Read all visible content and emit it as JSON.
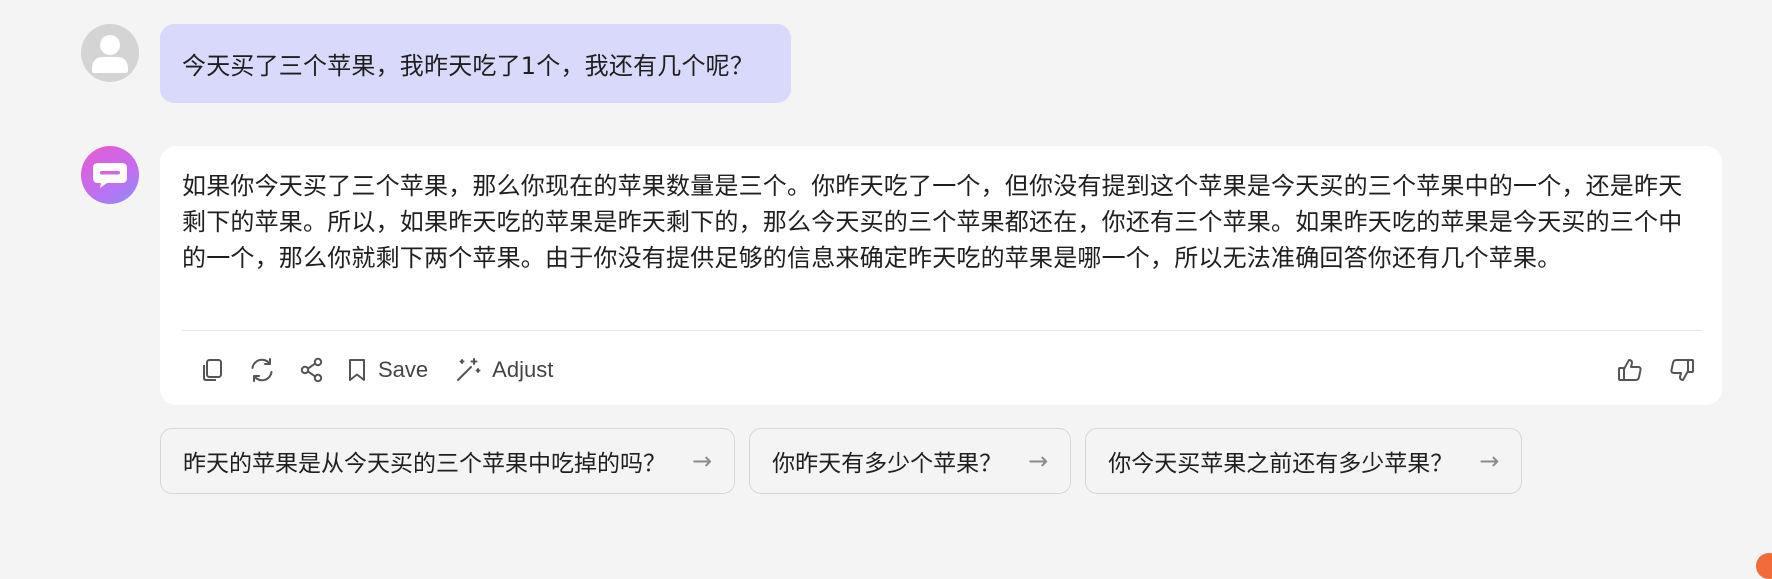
{
  "user_message": {
    "text": "今天买了三个苹果，我昨天吃了1个，我还有几个呢？"
  },
  "bot_message": {
    "text": "如果你今天买了三个苹果，那么你现在的苹果数量是三个。你昨天吃了一个，但你没有提到这个苹果是今天买的三个苹果中的一个，还是昨天剩下的苹果。所以，如果昨天吃的苹果是昨天剩下的，那么今天买的三个苹果都还在，你还有三个苹果。如果昨天吃的苹果是今天买的三个中的一个，那么你就剩下两个苹果。由于你没有提供足够的信息来确定昨天吃的苹果是哪一个，所以无法准确回答你还有几个苹果。"
  },
  "actions": {
    "copy_icon": "copy-icon",
    "regenerate_icon": "refresh-icon",
    "share_icon": "share-icon",
    "save_label": "Save",
    "adjust_label": "Adjust",
    "like_icon": "thumbs-up-icon",
    "dislike_icon": "thumbs-down-icon"
  },
  "suggestions": [
    {
      "text": "昨天的苹果是从今天买的三个苹果中吃掉的吗？",
      "arrow": "→"
    },
    {
      "text": "你昨天有多少个苹果？",
      "arrow": "→"
    },
    {
      "text": "你今天买苹果之前还有多少苹果？",
      "arrow": "→"
    }
  ],
  "colors": {
    "background": "#f4f4f4",
    "user_bubble": "#d9d9fb",
    "bot_card": "#ffffff",
    "bot_avatar_gradient": [
      "#e85bd0",
      "#8f8cf7"
    ],
    "accent_corner": "#f06a3a"
  }
}
